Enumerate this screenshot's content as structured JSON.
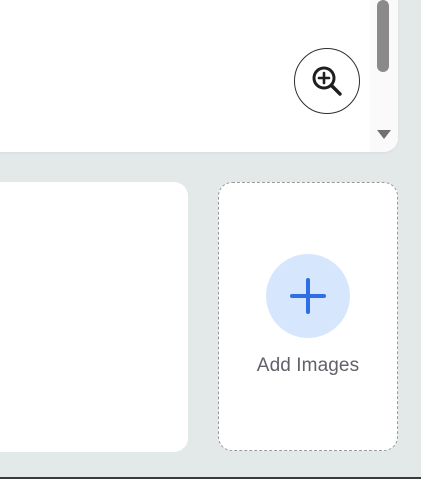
{
  "preview": {
    "zoom_icon": "zoom-in-icon",
    "scroll_down_icon": "triangle-down-icon"
  },
  "add_images": {
    "label": "Add Images",
    "icon": "plus-icon",
    "accent_color": "#2f6fe4",
    "circle_color": "#d6e6fd"
  }
}
